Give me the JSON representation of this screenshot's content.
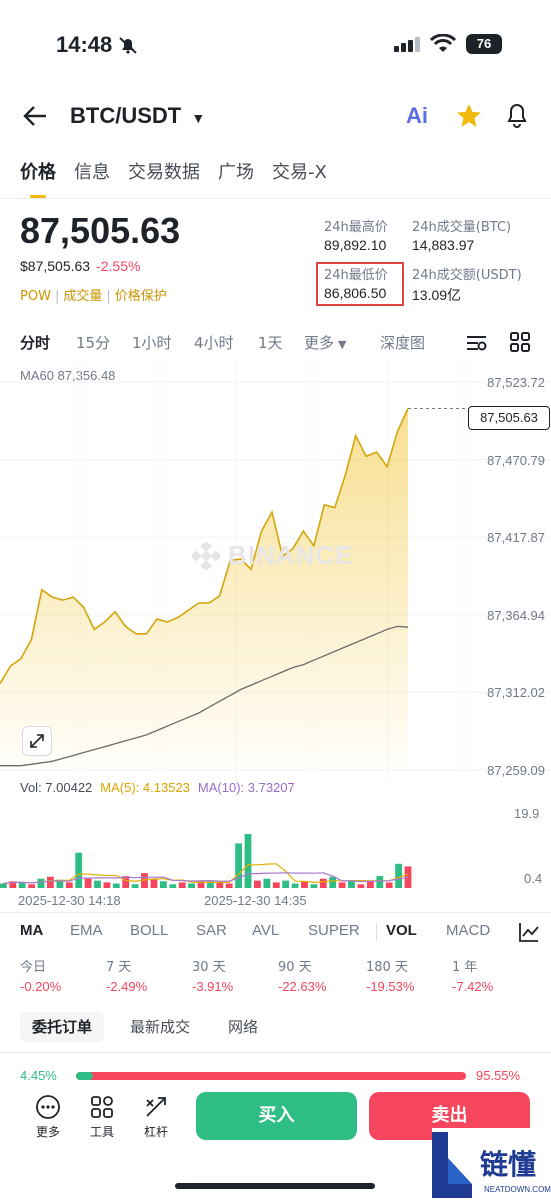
{
  "status": {
    "time": "14:48",
    "battery": "76"
  },
  "header": {
    "pair": "BTC/USDT",
    "ai_label": "Ai"
  },
  "tabs": [
    "价格",
    "信息",
    "交易数据",
    "广场",
    "交易-X"
  ],
  "price": {
    "last": "87,505.63",
    "usd": "$87,505.63",
    "change": "-2.55%",
    "pow": "POW",
    "volume_link": "成交量",
    "protect_link": "价格保护"
  },
  "stats": {
    "high_label": "24h最高价",
    "high": "89,892.10",
    "vol_btc_label": "24h成交量(BTC)",
    "vol_btc": "14,883.97",
    "low_label": "24h最低价",
    "low": "86,806.50",
    "vol_usdt_label": "24h成交额(USDT)",
    "vol_usdt": "13.09亿"
  },
  "intervals": [
    "分时",
    "15分",
    "1小时",
    "4小时",
    "1天",
    "更多",
    "深度图"
  ],
  "chart_header": {
    "ma60": "MA60 87,356.48"
  },
  "y_axis": [
    "87,523.72",
    "87,470.79",
    "87,417.87",
    "87,364.94",
    "87,312.02",
    "87,259.09"
  ],
  "current_price_tag": "87,505.63",
  "watermark": "BINANCE",
  "volume": {
    "vol_text": "Vol: 7.00422",
    "ma5_text": "MA(5): 4.13523",
    "ma10_text": "MA(10): 3.73207",
    "y_top": "19.9",
    "y_bottom": "0.4"
  },
  "time_labels": [
    "2025-12-30 14:18",
    "2025-12-30 14:35"
  ],
  "indicators": [
    "MA",
    "EMA",
    "BOLL",
    "SAR",
    "AVL",
    "SUPER",
    "VOL",
    "MACD"
  ],
  "performance": [
    {
      "label": "今日",
      "value": "-0.20%"
    },
    {
      "label": "7 天",
      "value": "-2.49%"
    },
    {
      "label": "30 天",
      "value": "-3.91%"
    },
    {
      "label": "90 天",
      "value": "-22.63%"
    },
    {
      "label": "180 天",
      "value": "-19.53%"
    },
    {
      "label": "1 年",
      "value": "-7.42%"
    }
  ],
  "order_tabs": [
    "委托订单",
    "最新成交",
    "网络"
  ],
  "order_ratio": {
    "buy": "4.45%",
    "sell": "95.55%",
    "buy_fraction": 0.0445
  },
  "bottom": {
    "more": "更多",
    "tools": "工具",
    "leverage": "杠杆",
    "buy": "买入",
    "sell": "卖出"
  },
  "colors": {
    "accent": "#f0b90b",
    "buy": "#2ebd85",
    "sell": "#f6465d"
  },
  "chart_data": {
    "type": "area",
    "title": "",
    "ylim": [
      87259.09,
      87523.72
    ],
    "price_series": [
      87318,
      87330,
      87335,
      87348,
      87382,
      87377,
      87375,
      87377,
      87370,
      87355,
      87360,
      87367,
      87357,
      87352,
      87352,
      87362,
      87360,
      87363,
      87368,
      87373,
      87373,
      87378,
      87402,
      87403,
      87396,
      87422,
      87435,
      87405,
      87410,
      87422,
      87412,
      87440,
      87438,
      87460,
      87487,
      87473,
      87476,
      87466,
      87490,
      87505.63
    ],
    "ma60_series": [
      87262,
      87262,
      87262,
      87263,
      87264,
      87265,
      87267,
      87269,
      87271,
      87273,
      87275,
      87277,
      87279,
      87281,
      87283,
      87286,
      87289,
      87292,
      87295,
      87298,
      87302,
      87306,
      87310,
      87314,
      87317,
      87320,
      87323,
      87326,
      87329,
      87331,
      87334,
      87337,
      87340,
      87343,
      87346,
      87349,
      87352,
      87355,
      87357,
      87356.48
    ],
    "volume_series": [
      1.2,
      1.8,
      1.5,
      1.0,
      2.5,
      3.0,
      2.2,
      1.5,
      9.5,
      2.5,
      2.0,
      1.5,
      1.2,
      3.2,
      1.0,
      4.0,
      2.5,
      1.8,
      1.0,
      1.5,
      1.2,
      2.0,
      1.8,
      1.5,
      1.2,
      12.0,
      14.5,
      2.0,
      2.5,
      1.5,
      2.0,
      1.2,
      1.8,
      1.0,
      2.5,
      3.0,
      1.5,
      2.0,
      1.0,
      2.0,
      3.2,
      1.5,
      6.5,
      5.8
    ],
    "volume_colors": [
      "g",
      "r",
      "g",
      "r",
      "g",
      "r",
      "g",
      "r",
      "g",
      "r",
      "g",
      "r",
      "g",
      "r",
      "g",
      "r",
      "r",
      "g",
      "g",
      "r",
      "g",
      "r",
      "g",
      "r",
      "r",
      "g",
      "g",
      "r",
      "g",
      "r",
      "g",
      "g",
      "r",
      "g",
      "r",
      "g",
      "r",
      "g",
      "r",
      "r",
      "g",
      "r",
      "g",
      "r"
    ],
    "volume_ylim": [
      0.4,
      19.9
    ]
  }
}
